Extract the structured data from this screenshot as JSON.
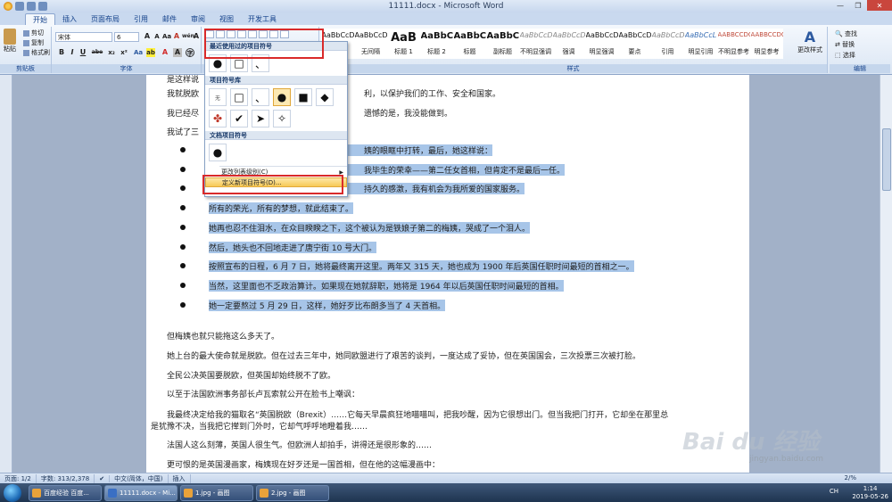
{
  "window": {
    "title": "11111.docx - Microsoft Word"
  },
  "tabs": [
    "开始",
    "插入",
    "页面布局",
    "引用",
    "邮件",
    "审阅",
    "视图",
    "开发工具"
  ],
  "ribbon": {
    "clipboard": {
      "paste": "粘贴",
      "cut": "剪切",
      "copy": "复制",
      "format_painter": "格式刷",
      "label": "剪贴板"
    },
    "font": {
      "name": "宋体",
      "size": "6",
      "label": "字体",
      "grow": "A",
      "shrink": "A",
      "aa": "Aa",
      "clear": "A",
      "wen": "wén",
      "bold": "B",
      "italic": "I",
      "underline": "U",
      "strike": "abe",
      "sub": "x₂",
      "sup": "x²",
      "effects": "Aa",
      "highlight": "ab",
      "fontcolor": "A",
      "charshade": "A",
      "border": "A",
      "circle": "字"
    },
    "paragraph": {
      "label": "段落"
    },
    "styles": {
      "label": "样式",
      "tiles": [
        {
          "preview": "AaBbCcD",
          "name": "正文",
          "cls": ""
        },
        {
          "preview": "AaBbCcD",
          "name": "无间隔",
          "cls": ""
        },
        {
          "preview": "AaB",
          "name": "标题 1",
          "cls": "big"
        },
        {
          "preview": "AaBbC",
          "name": "标题 2",
          "cls": "h2"
        },
        {
          "preview": "AaBbC",
          "name": "标题",
          "cls": "h2"
        },
        {
          "preview": "AaBbC",
          "name": "副标题",
          "cls": "h2"
        },
        {
          "preview": "AaBbCcDc",
          "name": "不明显强调",
          "cls": "faint"
        },
        {
          "preview": "AaBbCcDc",
          "name": "强调",
          "cls": "faint"
        },
        {
          "preview": "AaBbCcDc",
          "name": "明显强调",
          "cls": ""
        },
        {
          "preview": "AaBbCcDc",
          "name": "要点",
          "cls": ""
        },
        {
          "preview": "AaBbCcD",
          "name": "引用",
          "cls": "faint"
        },
        {
          "preview": "AaBbCcL",
          "name": "明显引用",
          "cls": "accent"
        },
        {
          "preview": "AABBCCDC",
          "name": "不明显参考",
          "cls": "red"
        },
        {
          "preview": "AABBCCDC",
          "name": "明显参考",
          "cls": "red"
        }
      ],
      "change": "更改样式"
    },
    "editing": {
      "find": "查找",
      "replace": "替换",
      "select": "选择",
      "label": "编辑"
    }
  },
  "bullet_menu": {
    "recent_header": "最近使用过的项目符号",
    "recent": [
      "●",
      "□",
      "、"
    ],
    "library_header": "项目符号库",
    "library": [
      "无",
      "□",
      "、",
      "●",
      "■",
      "◆",
      "✤",
      "✔",
      "➤",
      "✧"
    ],
    "doc_header": "文档项目符号",
    "doc": [
      "●"
    ],
    "change_level": "更改列表级别(C)",
    "define_new": "定义新项目符号(D)..."
  },
  "document": {
    "lines": [
      {
        "text": "是这样说",
        "y": 0
      },
      {
        "text": "我就脱欧",
        "y": 0
      },
      {
        "text": "我已经尽",
        "y": 0
      },
      {
        "text": "我试了三",
        "y": 0
      }
    ],
    "line_a_tail": "利，以保护我们的工作、安全和国家。",
    "line_b_tail": "遗憾的是，我没能做到。",
    "bullets": [
      "姨的眼眶中打转，最后，她这样说：",
      "我毕生的荣幸——第二任女首相，但肯定不是最后一任。",
      "持久的感激，我有机会为我所爱的国家服务。",
      "所有的荣光，所有的梦想，就此结束了。",
      "她再也忍不住泪水，在众目睽睽之下，这个被认为是铁娘子第二的梅姨，哭成了一个泪人。",
      "然后，她头也不回地走进了唐宁街 10 号大门。",
      "按照宣布的日程，6 月 7 日，她将最终离开这里。两年又 315 天，她也成为 1900 年后英国任职时间最短的首相之一。",
      "当然，这里面也不乏政治算计。如果现在她就辞职，她将是 1964 年以后英国任职时间最短的首相。",
      "她一定要熬过 5 月 29 日，这样，她好歹比布朗多当了 4 天首相。"
    ],
    "paras": [
      "但梅姨也就只能拖这么多天了。",
      "她上台的最大使命就是脱欧。但在过去三年中，她同欧盟进行了艰苦的谈判，一度达成了妥协，但在英国国会，三次投票三次被打脸。",
      "全民公决英国要脱欧，但英国却始终脱不了欧。",
      "以至于法国欧洲事务部长卢瓦索就公开在脸书上嘲讽：",
      "我最终决定给我的猫取名“英国脱欧（Brexit）……它每天早晨疯狂地喵喵叫，把我吵醒，因为它很想出门。但当我把门打开，它却坐在那里总",
      "是犹豫不决，当我把它撵到门外时，它却气呼呼地瞪着我……",
      "法国人这么刻薄，英国人很生气。但欧洲人却拍手，讲得还是很形象的……",
      "更可恨的是英国漫画家，梅姨现在好歹还是一国首相，但在他的这幅漫画中："
    ]
  },
  "status": {
    "page": "页面: 1/2",
    "words": "字数: 313/2,378",
    "lang": "中文(简体，中国)",
    "mode": "插入",
    "zoom": "2/%"
  },
  "taskbar": {
    "items": [
      "百度经验 百度...",
      "11111.docx - Mi...",
      "1.jpg - 画图",
      "2.jpg - 画图"
    ],
    "lang": "CH",
    "time": "1:14",
    "date": "2019-05-26"
  },
  "watermark": {
    "logo": "Bai du 经验",
    "url": "jingyan.baidu.com"
  }
}
